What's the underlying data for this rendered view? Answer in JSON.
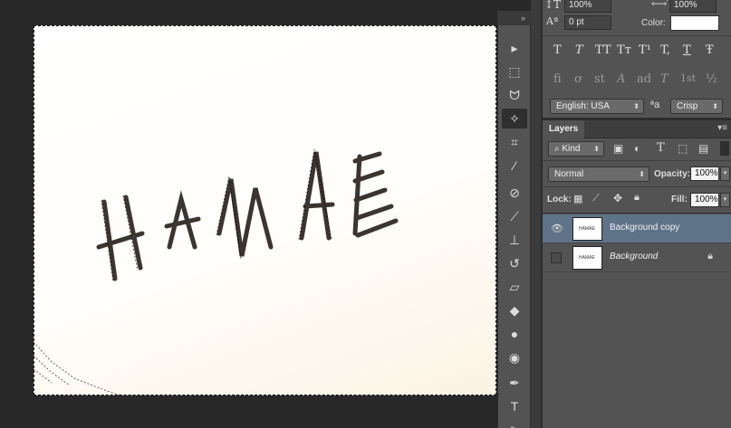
{
  "character": {
    "vertical_scale": "100%",
    "horizontal_scale": "100%",
    "baseline_shift": "0 pt",
    "color_label": "Color:",
    "color_value": "#ffffff",
    "language": "English: USA",
    "aa_label": "ªa",
    "antialias": "Crisp",
    "style_glyphs": [
      "T",
      "T",
      "TT",
      "Tт",
      "T¹",
      "T,",
      "T",
      "Ŧ"
    ],
    "opentype_glyphs": [
      "fi",
      "ơ",
      "st",
      "A",
      "ad",
      "T",
      "1st",
      "½"
    ]
  },
  "layers": {
    "tab_label": "Layers",
    "filter_kind": "Kind",
    "blend_mode": "Normal",
    "opacity_label": "Opacity:",
    "opacity_value": "100%",
    "lock_label": "Lock:",
    "fill_label": "Fill:",
    "fill_value": "100%",
    "items": [
      {
        "name": "Background copy",
        "visible": true,
        "selected": true,
        "thumb_text": "HAMAE"
      },
      {
        "name": "Background",
        "visible": false,
        "selected": false,
        "thumb_text": "HAMAE",
        "locked": true
      }
    ]
  },
  "tools": {
    "collapse_label": "»",
    "items": [
      "move-tool",
      "marquee-tool",
      "lasso-tool",
      "magic-wand-tool",
      "crop-tool",
      "eyedropper-tool",
      "healing-brush-tool",
      "brush-tool",
      "clone-stamp-tool",
      "history-brush-tool",
      "eraser-tool",
      "paint-bucket-tool",
      "blur-tool",
      "dodge-tool",
      "pen-tool",
      "type-tool",
      "path-selection-tool"
    ]
  },
  "colors": {
    "panel": "#535353",
    "selected_layer": "#5e7288",
    "background": "#282828"
  }
}
